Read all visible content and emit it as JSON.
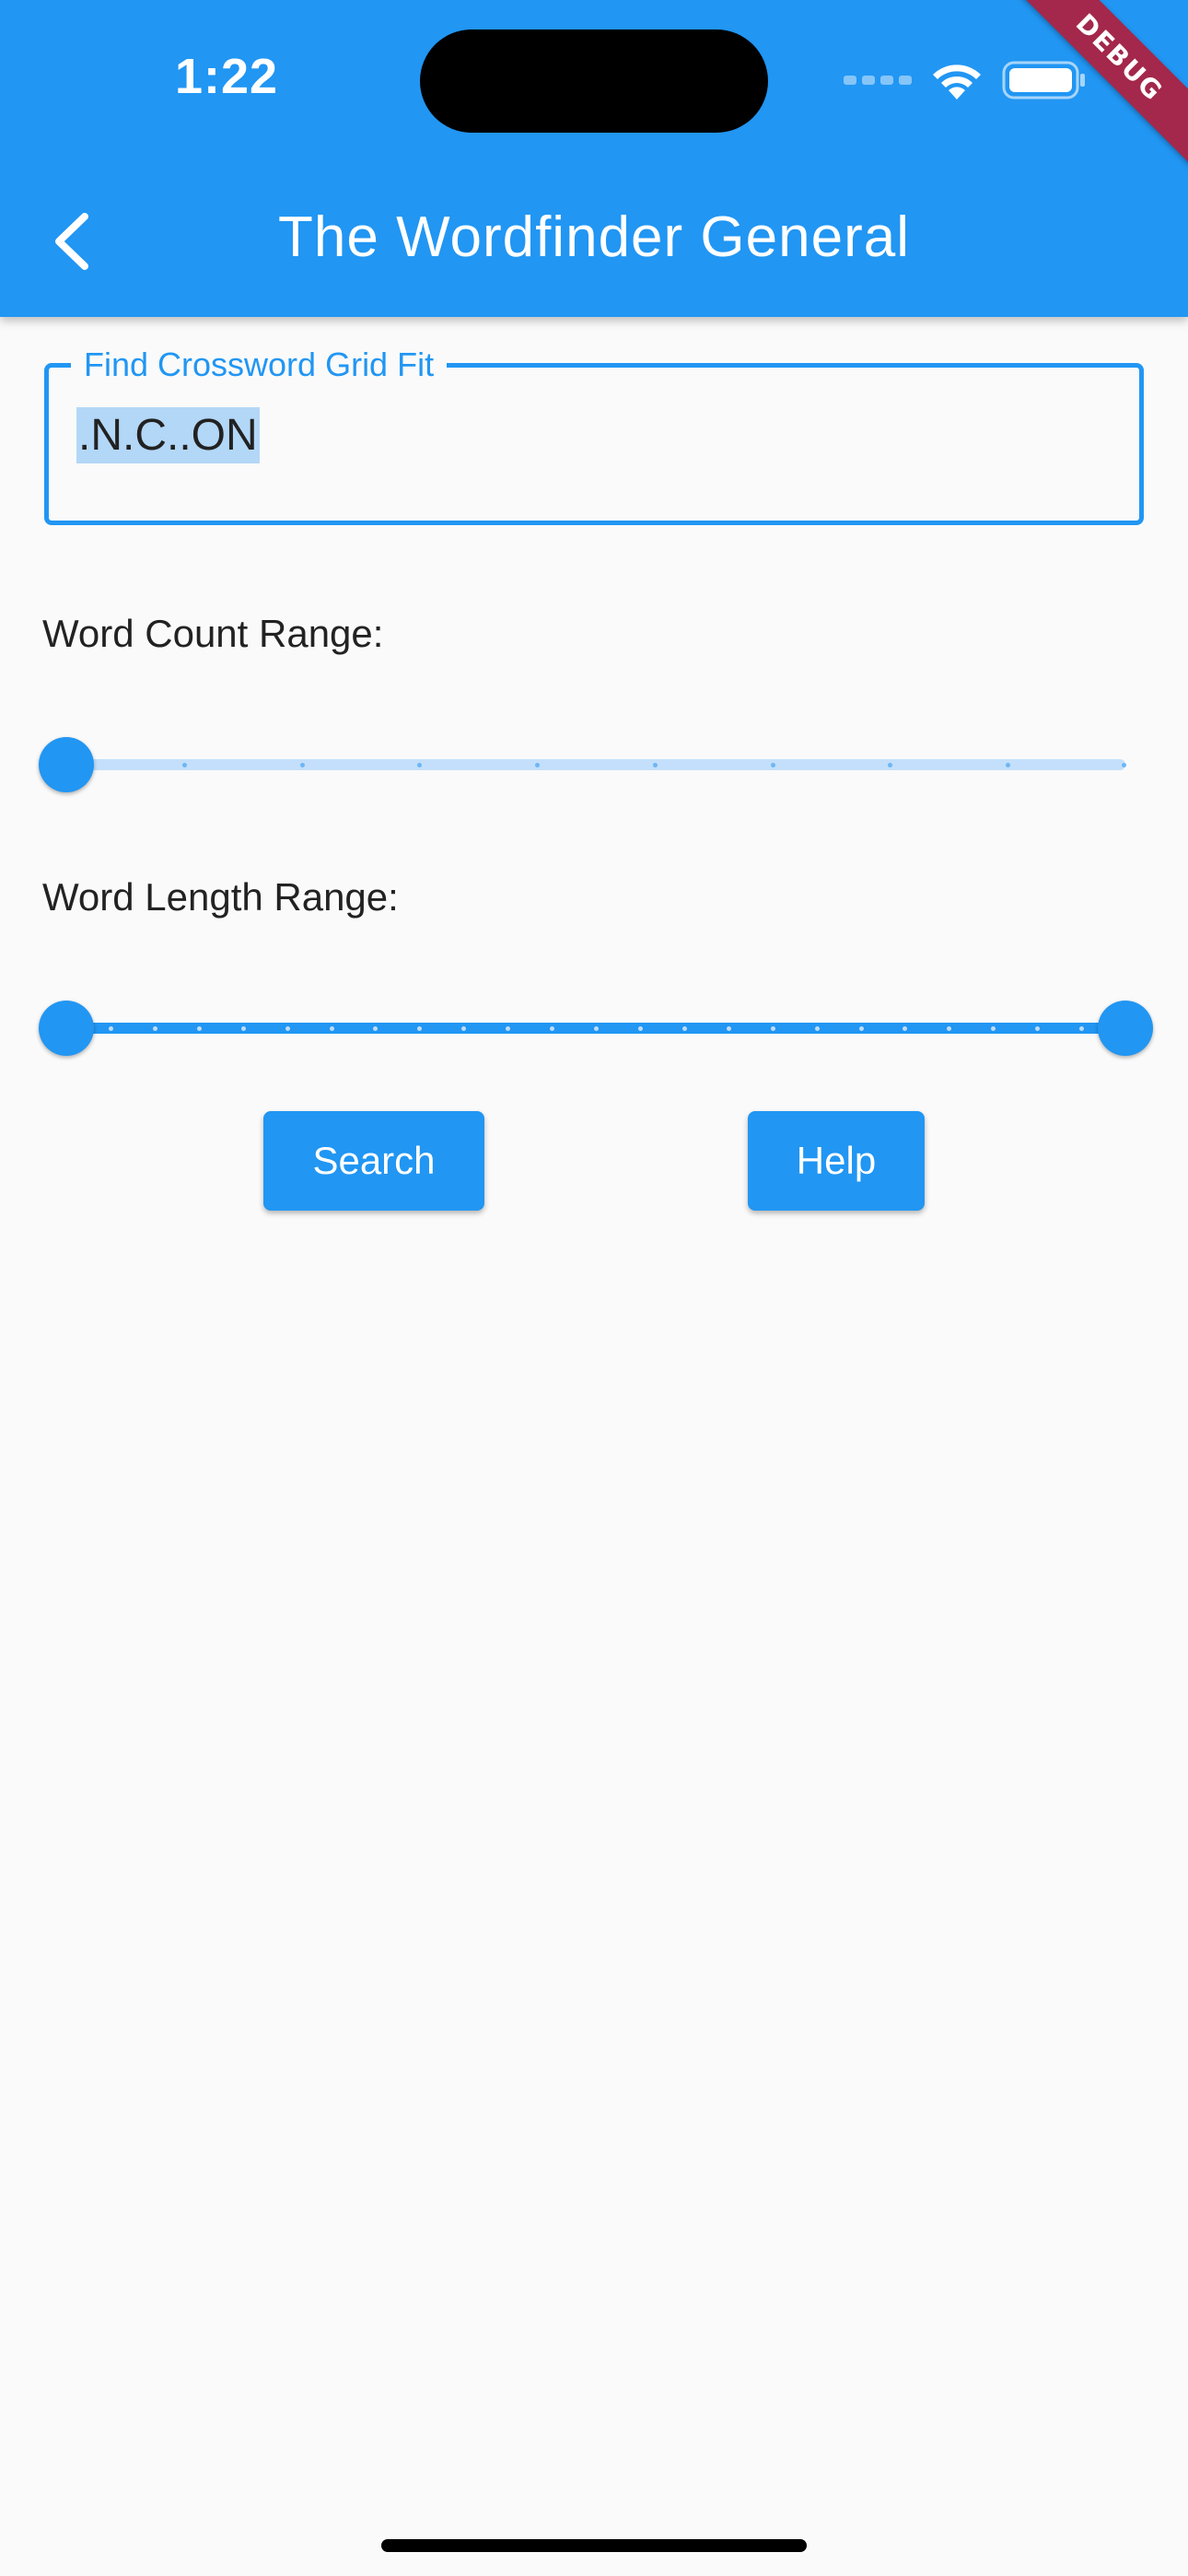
{
  "status_bar": {
    "time": "1:22",
    "icons": [
      "signal-icon",
      "wifi-icon",
      "battery-icon"
    ]
  },
  "debug_banner": "DEBUG",
  "app_bar": {
    "title": "The Wordfinder General",
    "back_icon": "chevron-left-icon"
  },
  "crossword_field": {
    "label": "Find Crossword Grid Fit",
    "value": ".N.C..ON"
  },
  "word_count": {
    "label": "Word Count Range:",
    "range_fraction": [
      0,
      0
    ],
    "divisions": 9
  },
  "word_length": {
    "label": "Word Length Range:",
    "range_fraction": [
      0,
      1
    ],
    "divisions": 24
  },
  "buttons": {
    "search": "Search",
    "help": "Help"
  },
  "colors": {
    "primary": "#2196f3",
    "background": "#fafafa",
    "debug": "#a3284b"
  }
}
